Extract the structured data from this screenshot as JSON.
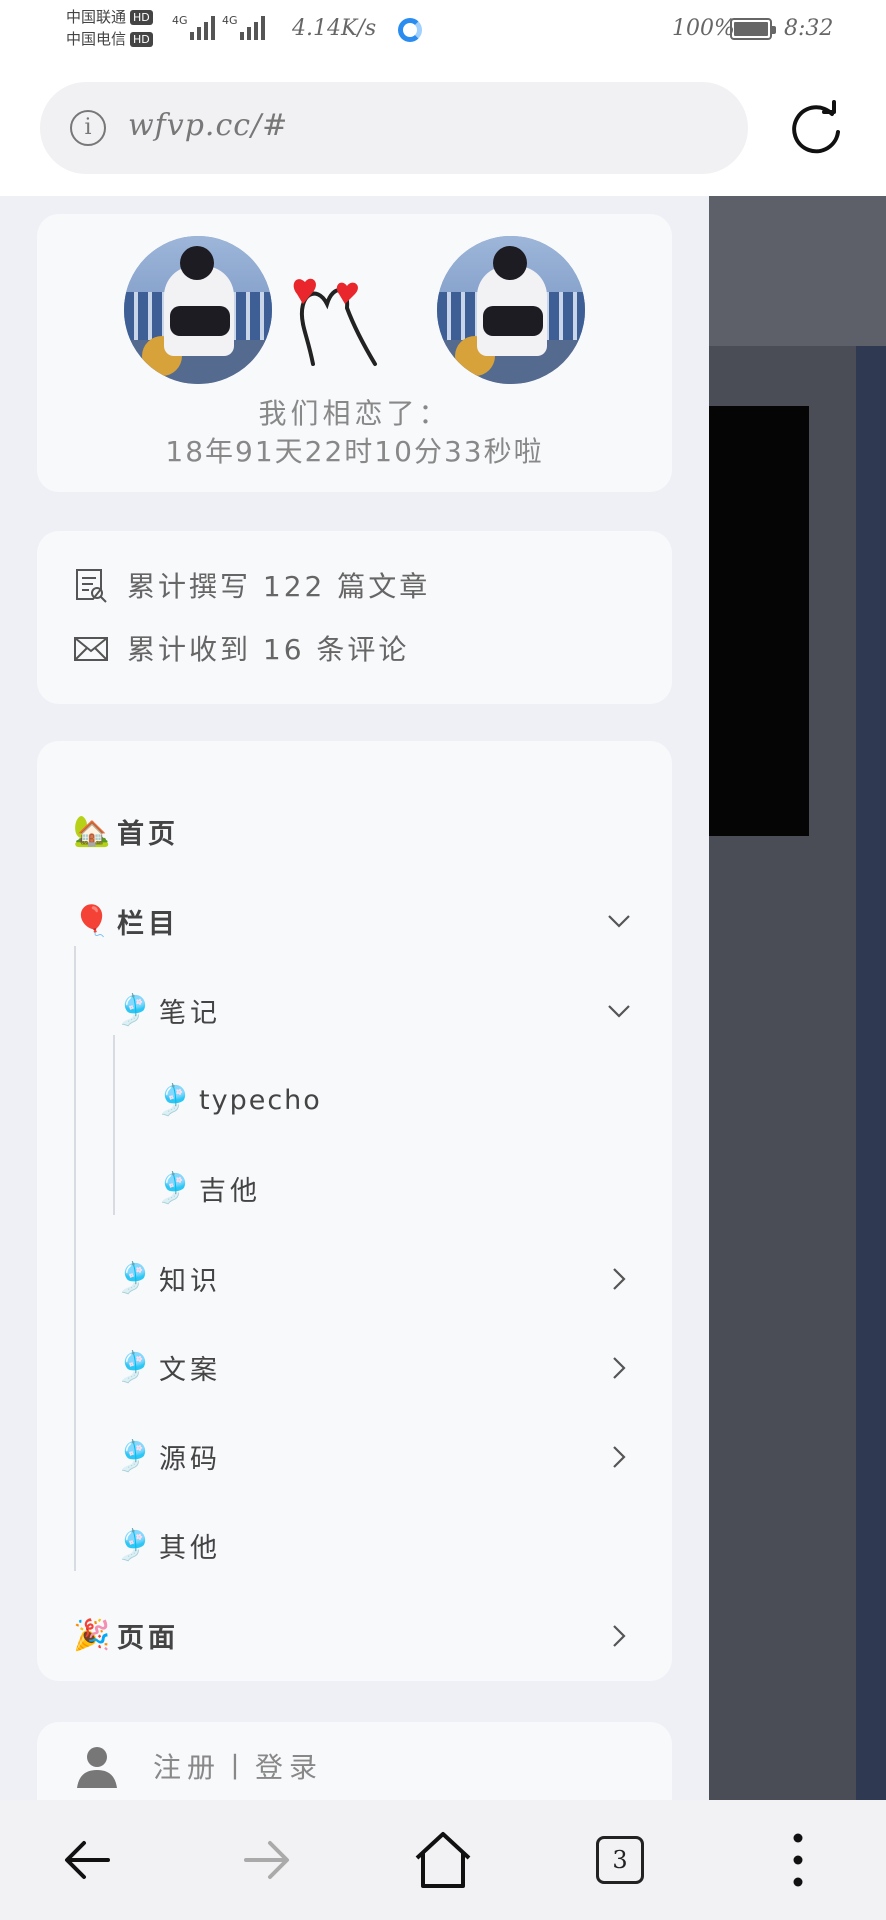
{
  "status_bar": {
    "carrier_1": "中国联通",
    "carrier_2": "中国电信",
    "hd": "HD",
    "network": "4G",
    "speed": "4.14K/s",
    "battery": "100%",
    "time": "8:32"
  },
  "browser": {
    "url": "wfvp.cc/#",
    "open_tabs": "3"
  },
  "love_card": {
    "line1": "我们相恋了：",
    "line2": "18年91天22时10分33秒啦"
  },
  "stats": {
    "articles": "累计撰写 122 篇文章",
    "comments": "累计收到 16 条评论"
  },
  "nav": {
    "home": "首页",
    "columns": "栏目",
    "notes": "笔记",
    "typecho": "typecho",
    "guitar": "吉他",
    "knowledge": "知识",
    "copywriting": "文案",
    "source": "源码",
    "other": "其他",
    "pages": "页面"
  },
  "account": {
    "login": "注册丨登录"
  }
}
